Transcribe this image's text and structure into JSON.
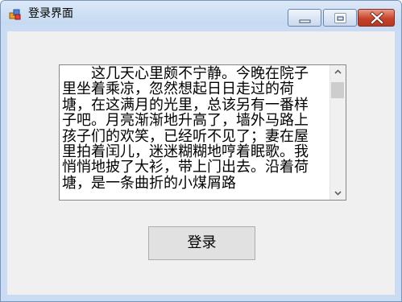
{
  "window": {
    "title": "登录界面",
    "icon": "windows-forms-app-icon",
    "controls": {
      "minimize_icon": "minimize-icon",
      "maximize_icon": "maximize-icon",
      "close_icon": "close-icon"
    }
  },
  "textbox": {
    "content": "这几天心里颇不宁静。今晚在院子里坐着乘凉，忽然想起日日走过的荷塘，在这满月的光里，总该另有一番样子吧。月亮渐渐地升高了，墙外马路上孩子们的欢笑，已经听不见了；妻在屋里拍着闰儿，迷迷糊糊地哼着眠歌。我悄悄地披了大衫，带上门出去。沿着荷塘，是一条曲折的小煤屑路",
    "scrollbar": {
      "up_icon": "scroll-up-arrow-icon",
      "down_icon": "scroll-down-arrow-icon"
    }
  },
  "login_button": {
    "label": "登录"
  },
  "colors": {
    "titlebar": "#c9dcf3",
    "client_background": "#f0f0f0",
    "close_button": "#c7432a"
  }
}
